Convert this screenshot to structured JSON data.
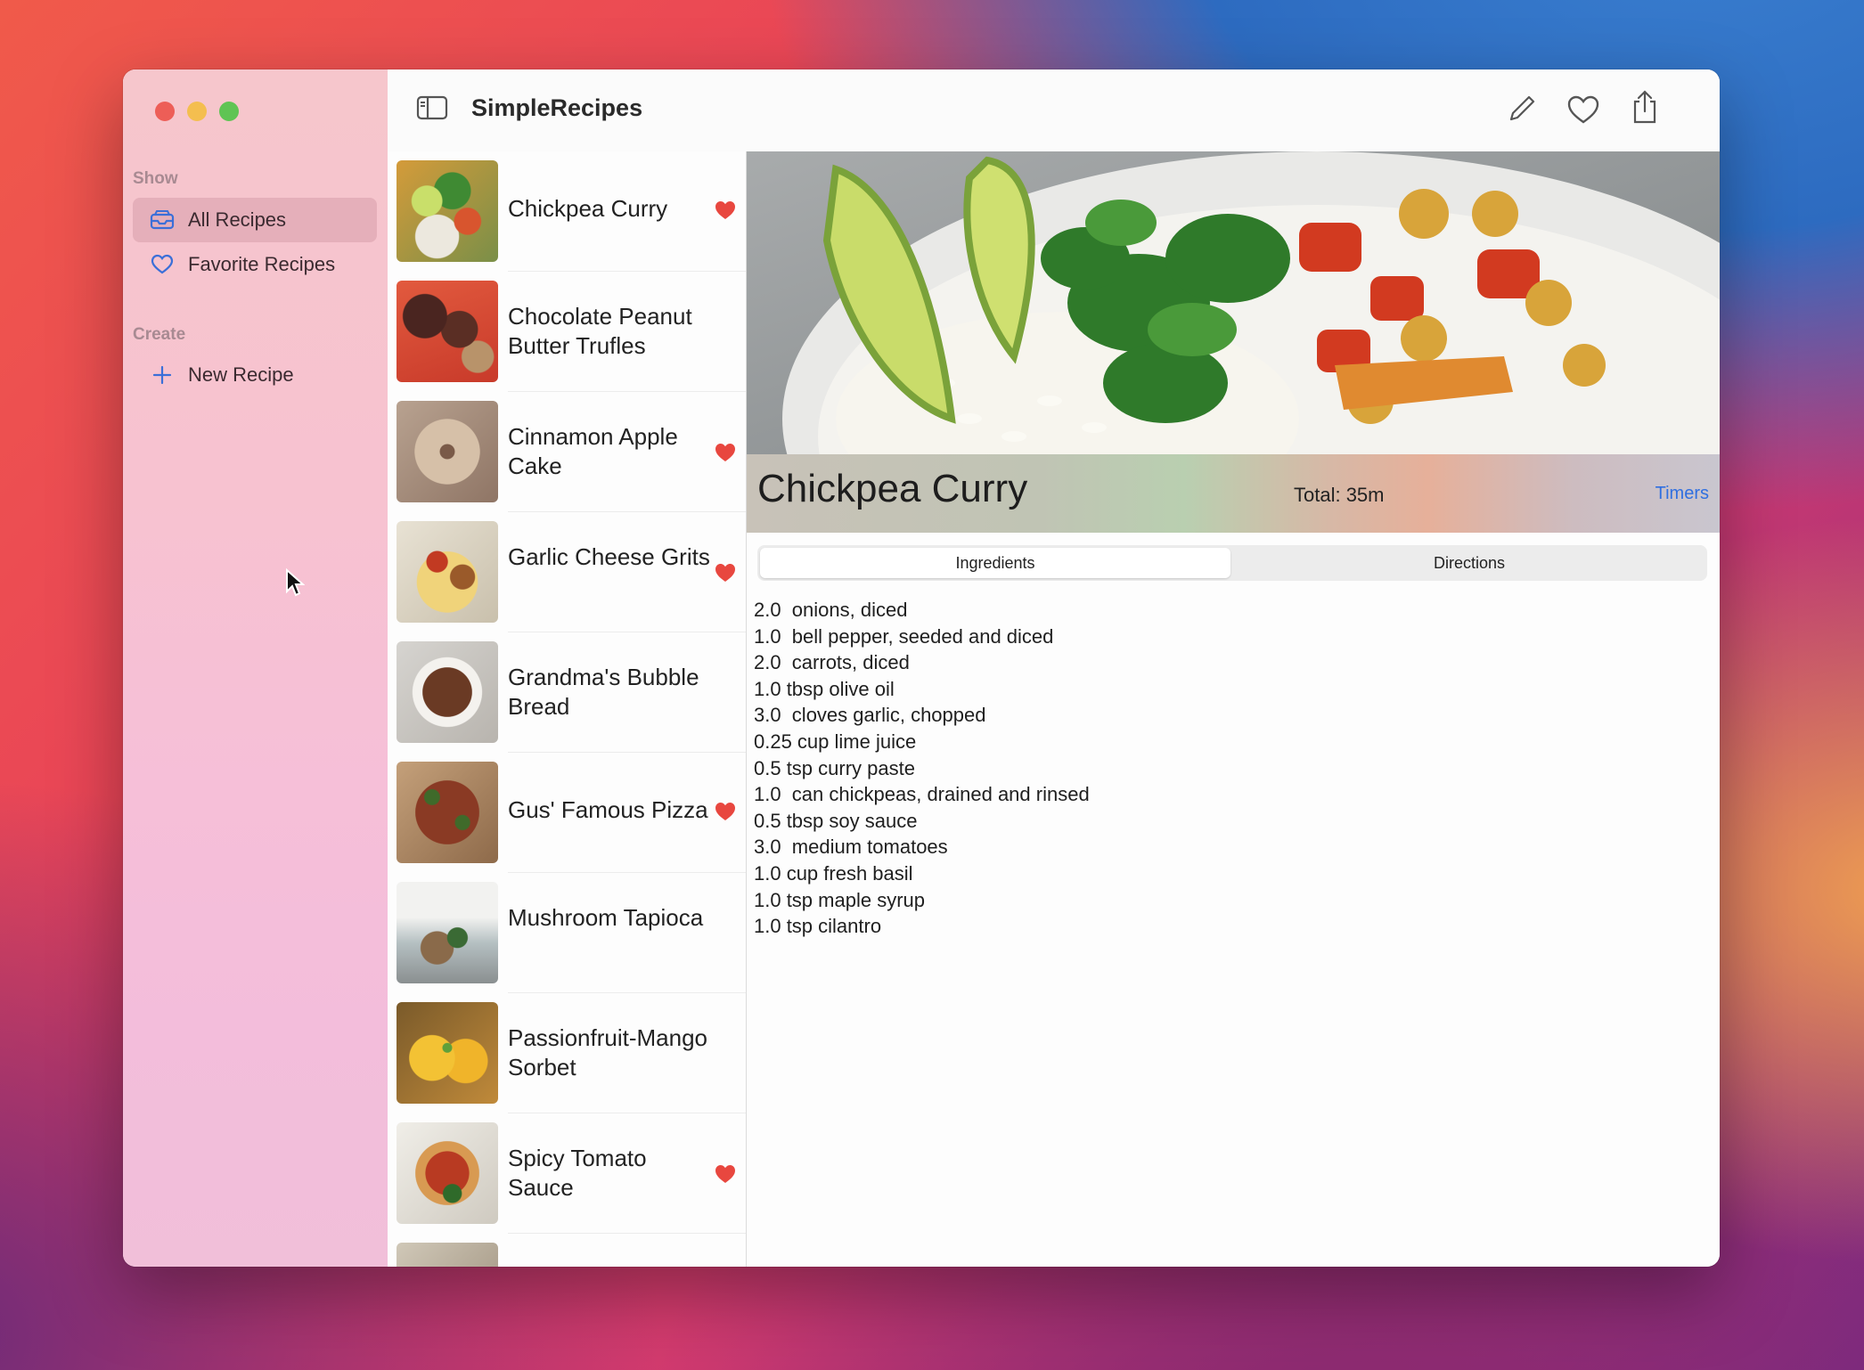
{
  "app": {
    "title": "SimpleRecipes"
  },
  "sidebar": {
    "show_label": "Show",
    "create_label": "Create",
    "items": [
      {
        "label": "All Recipes",
        "icon": "tray-icon",
        "selected": true
      },
      {
        "label": "Favorite Recipes",
        "icon": "heart-outline-icon",
        "selected": false
      }
    ],
    "new_recipe_label": "New Recipe"
  },
  "toolbar": {
    "icons": [
      "sidebar-toggle-icon",
      "pencil-icon",
      "heart-outline-icon",
      "share-icon"
    ]
  },
  "recipes": [
    {
      "name": "Chickpea Curry",
      "favorite": true
    },
    {
      "name": "Chocolate Peanut Butter Trufles",
      "favorite": false
    },
    {
      "name": "Cinnamon Apple Cake",
      "favorite": true
    },
    {
      "name": "Garlic Cheese Grits",
      "favorite": true
    },
    {
      "name": "Grandma's Bubble Bread",
      "favorite": false
    },
    {
      "name": "Gus' Famous Pizza",
      "favorite": true
    },
    {
      "name": "Mushroom Tapioca",
      "favorite": false
    },
    {
      "name": "Passionfruit-Mango Sorbet",
      "favorite": false
    },
    {
      "name": "Spicy Tomato Sauce",
      "favorite": true
    }
  ],
  "detail": {
    "title": "Chickpea Curry",
    "total": "Total: 35m",
    "timers": "Timers",
    "tabs": {
      "ingredients": "Ingredients",
      "directions": "Directions"
    },
    "ingredients": [
      "2.0  onions, diced",
      "1.0  bell pepper, seeded and diced",
      "2.0  carrots, diced",
      "1.0 tbsp olive oil",
      "3.0  cloves garlic, chopped",
      "0.25 cup lime juice",
      "0.5 tsp curry paste",
      "1.0  can chickpeas, drained and rinsed",
      "0.5 tbsp soy sauce",
      "3.0  medium tomatoes",
      "1.0 cup fresh basil",
      "1.0 tsp maple syrup",
      "1.0 tsp cilantro"
    ]
  },
  "colors": {
    "accent": "#2f6fe0",
    "heart": "#e8473f",
    "sidebar_selected": "#e3b0bc"
  }
}
